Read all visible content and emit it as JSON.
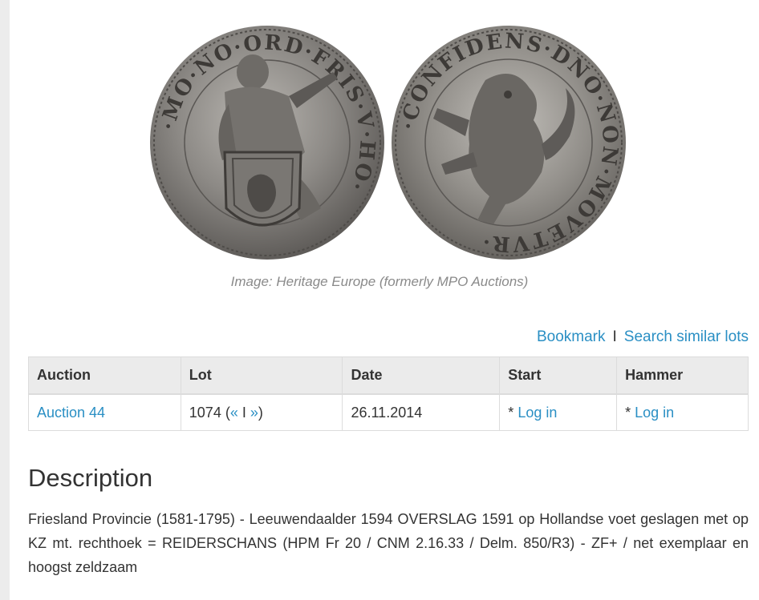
{
  "image": {
    "caption": "Image: Heritage Europe (formerly MPO Auctions)",
    "obverse_legend": "·MO·NO·ORD·FRIS·V·HO·",
    "reverse_legend": "·CONFIDENS·DNO·NON·MOVETVR·"
  },
  "actions": {
    "bookmark": "Bookmark",
    "separator": "I",
    "search_similar": "Search similar lots"
  },
  "table": {
    "headers": {
      "auction": "Auction",
      "lot": "Lot",
      "date": "Date",
      "start": "Start",
      "hammer": "Hammer"
    },
    "row": {
      "auction": "Auction 44",
      "lot_number": "1074",
      "lot_open": " (",
      "prev": "«",
      "lot_sep": " I ",
      "next": "»",
      "lot_close": ")",
      "date": "26.11.2014",
      "start_prefix": "* ",
      "start_link": "Log in",
      "hammer_prefix": "* ",
      "hammer_link": "Log in"
    }
  },
  "description": {
    "title": "Description",
    "text": "Friesland Provincie (1581-1795) - Leeuwendaalder 1594 OVERSLAG 1591 op Hollandse voet geslagen met op KZ mt. rechthoek = REIDERSCHANS (HPM Fr 20 / CNM 2.16.33 / Delm. 850/R3) - ZF+ / net exemplaar en hoogst zeldzaam"
  },
  "colors": {
    "link": "#2a8fc4",
    "header_bg": "#ebebeb",
    "coin_silver": "#8d8a86"
  }
}
